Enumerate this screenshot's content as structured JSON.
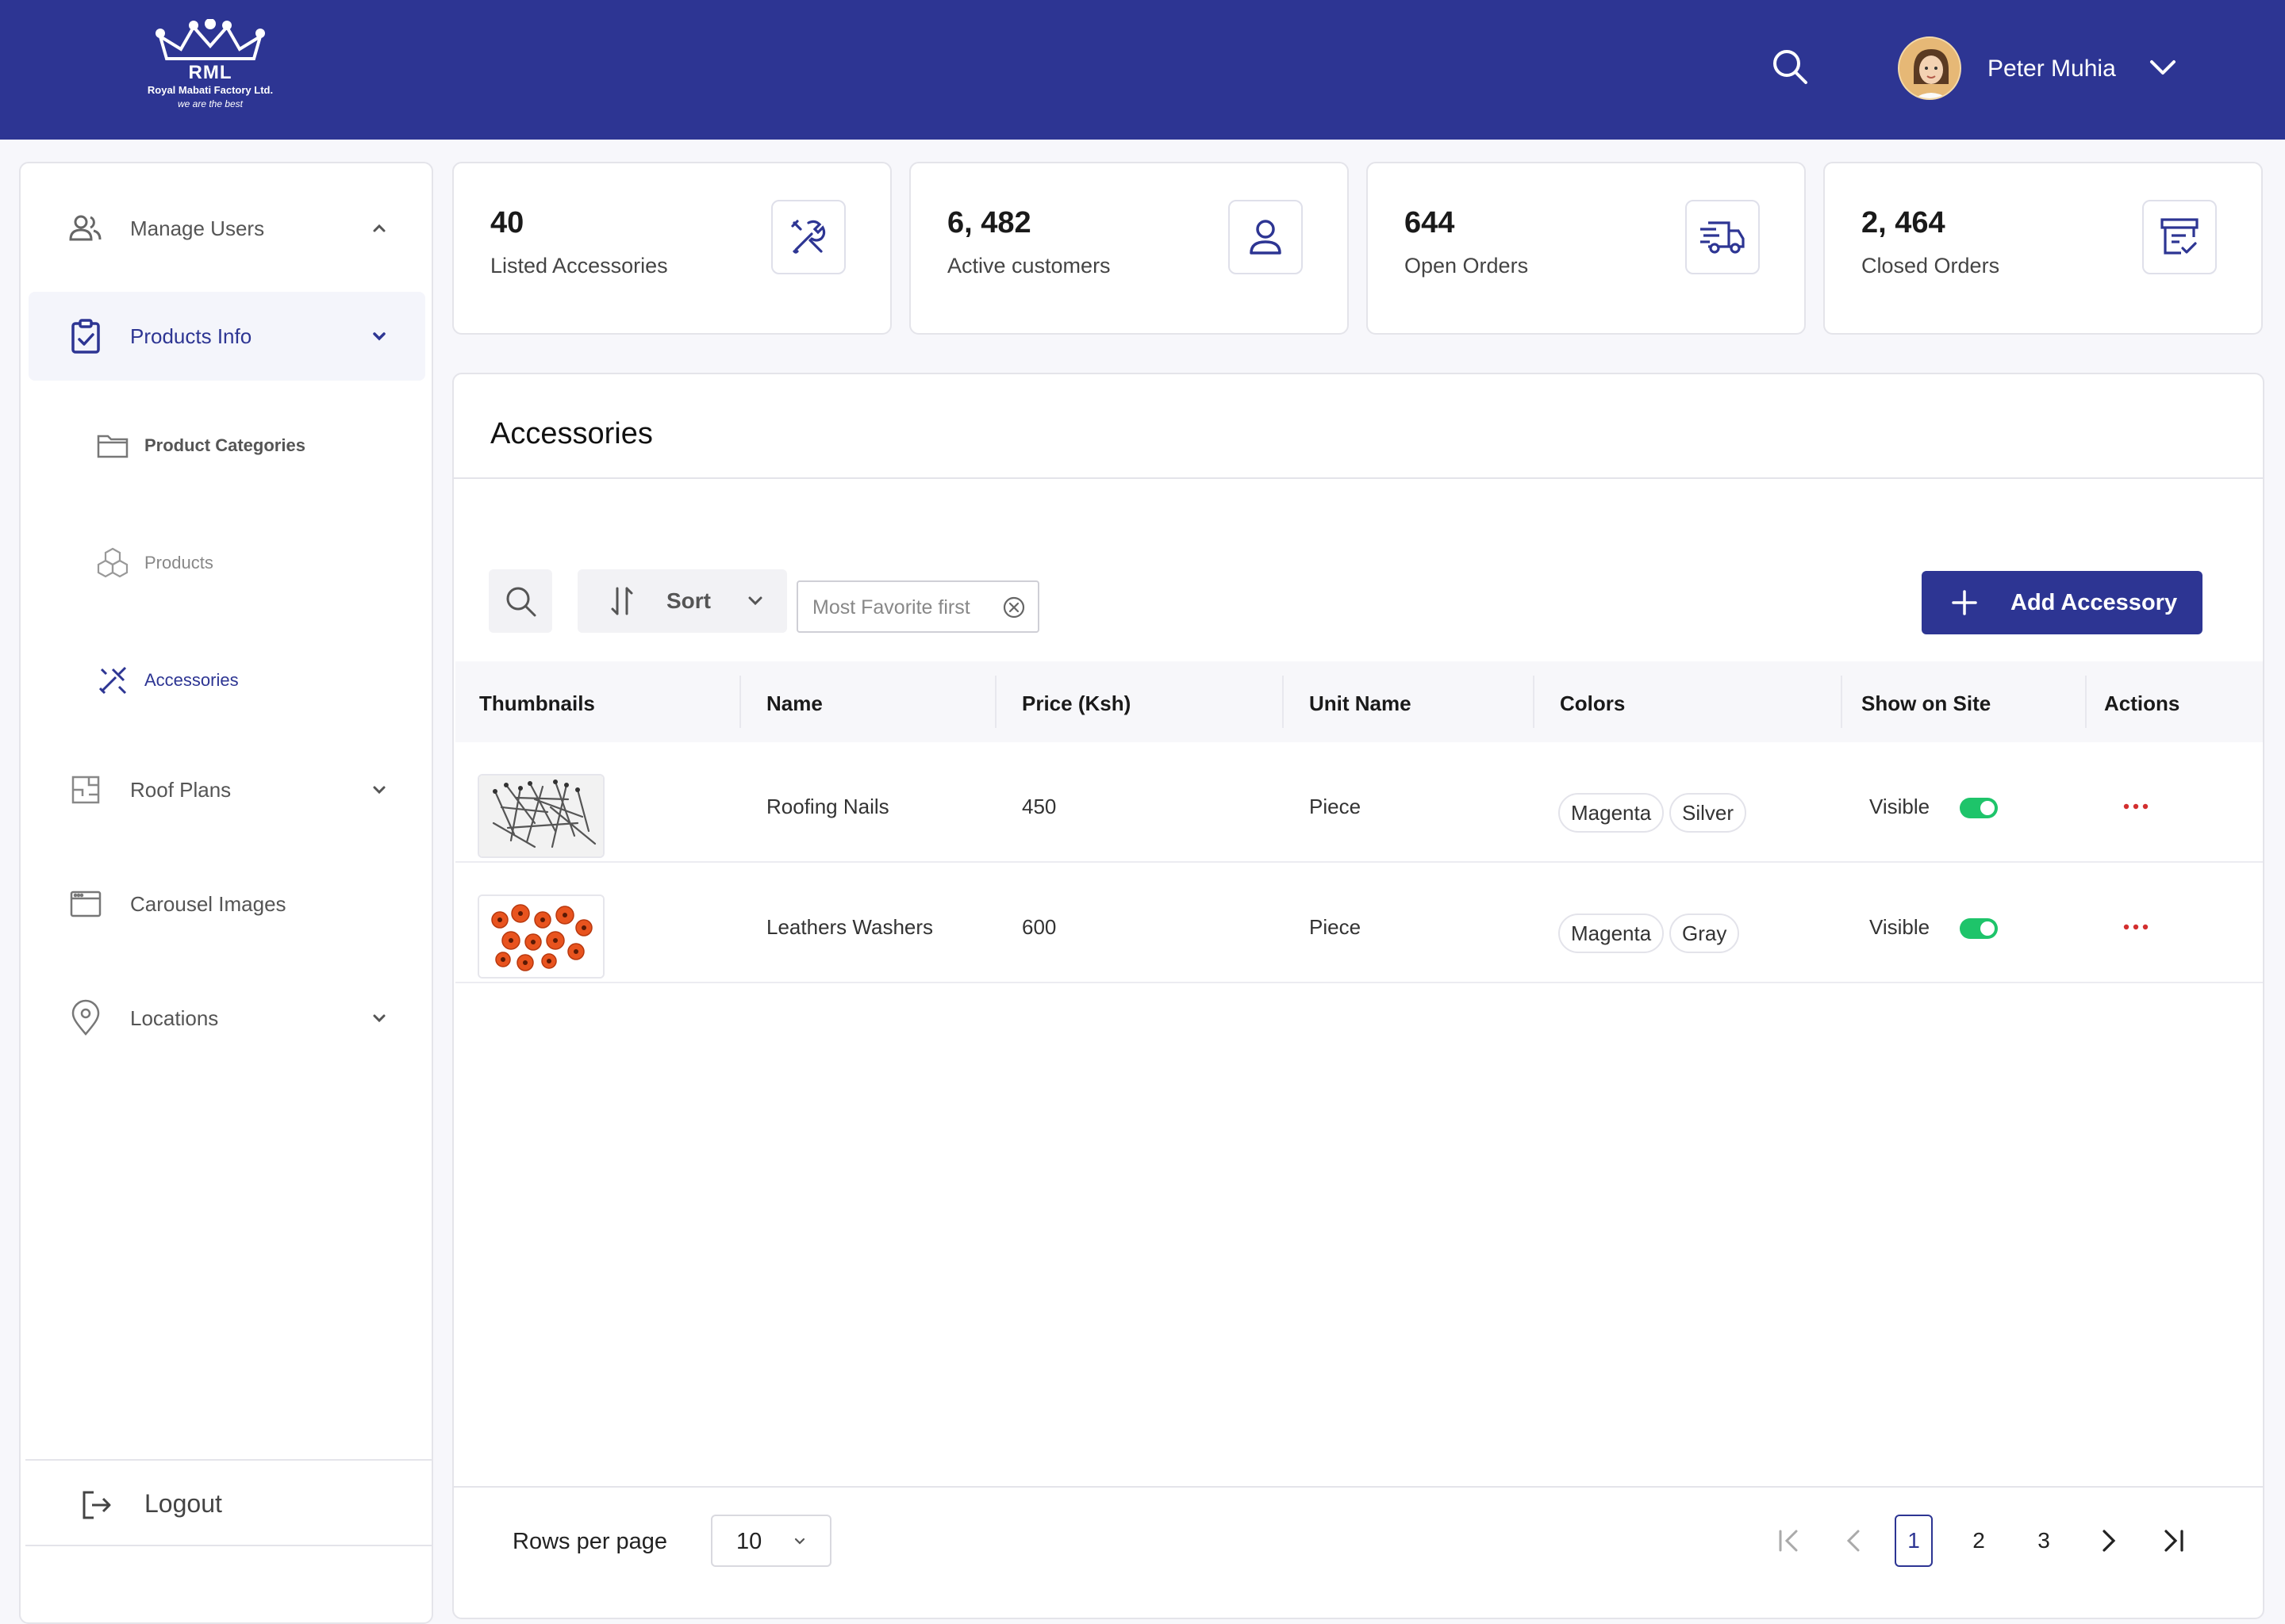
{
  "brand": {
    "logo_text": "RML",
    "company": "Royal Mabati Factory Ltd.",
    "tagline": "we are the best",
    "primary_color": "#2d3593"
  },
  "header": {
    "search_icon": "search-icon",
    "user_name": "Peter Muhia",
    "dropdown_icon": "chevron-down-icon"
  },
  "sidebar": {
    "items": [
      {
        "label": "Manage Users",
        "icon": "users-icon"
      },
      {
        "label": "Products Info",
        "icon": "clipboard-check-icon"
      },
      {
        "label": "Product Categories",
        "icon": "folder-icon"
      },
      {
        "label": "Products",
        "icon": "boxes-icon"
      },
      {
        "label": "Accessories",
        "icon": "tools-icon"
      },
      {
        "label": "Roof Plans",
        "icon": "floor-plan-icon"
      },
      {
        "label": "Carousel Images",
        "icon": "browser-window-icon"
      },
      {
        "label": "Locations",
        "icon": "map-pin-icon"
      }
    ],
    "logout_label": "Logout"
  },
  "stats": [
    {
      "value": "40",
      "label": "Listed Accessories",
      "icon": "tools-icon"
    },
    {
      "value": "6, 482",
      "label": "Active customers",
      "icon": "user-icon"
    },
    {
      "value": "644",
      "label": "Open Orders",
      "icon": "delivery-truck-icon"
    },
    {
      "value": "2, 464",
      "label": "Closed Orders",
      "icon": "archive-check-icon"
    }
  ],
  "main": {
    "title": "Accessories",
    "sort_label": "Sort",
    "filter_chip": "Most Favorite first",
    "add_button": "Add Accessory",
    "table": {
      "headers": [
        "Thumbnails",
        "Name",
        "Price (Ksh)",
        "Unit Name",
        "Colors",
        "Show on Site",
        "Actions"
      ],
      "rows": [
        {
          "name": "Roofing Nails",
          "price": "450",
          "unit": "Piece",
          "colors": [
            "Magenta",
            "Silver"
          ],
          "show": "Visible",
          "show_on": true
        },
        {
          "name": "Leathers Washers",
          "price": "600",
          "unit": "Piece",
          "colors": [
            "Magenta",
            "Gray"
          ],
          "show": "Visible",
          "show_on": true
        }
      ]
    },
    "pagination": {
      "rows_per_page_label": "Rows per page",
      "rows_per_page": "10",
      "pages": [
        "1",
        "2",
        "3"
      ],
      "current_page": "1"
    }
  }
}
